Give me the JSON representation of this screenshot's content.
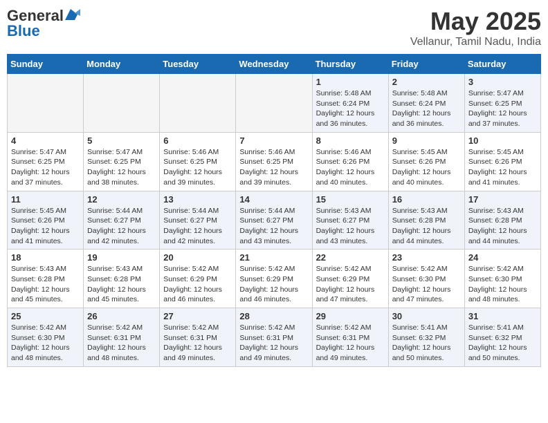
{
  "header": {
    "logo_line1": "General",
    "logo_line2": "Blue",
    "month_title": "May 2025",
    "location": "Vellanur, Tamil Nadu, India"
  },
  "weekdays": [
    "Sunday",
    "Monday",
    "Tuesday",
    "Wednesday",
    "Thursday",
    "Friday",
    "Saturday"
  ],
  "weeks": [
    [
      {
        "day": "",
        "info": ""
      },
      {
        "day": "",
        "info": ""
      },
      {
        "day": "",
        "info": ""
      },
      {
        "day": "",
        "info": ""
      },
      {
        "day": "1",
        "info": "Sunrise: 5:48 AM\nSunset: 6:24 PM\nDaylight: 12 hours\nand 36 minutes."
      },
      {
        "day": "2",
        "info": "Sunrise: 5:48 AM\nSunset: 6:24 PM\nDaylight: 12 hours\nand 36 minutes."
      },
      {
        "day": "3",
        "info": "Sunrise: 5:47 AM\nSunset: 6:25 PM\nDaylight: 12 hours\nand 37 minutes."
      }
    ],
    [
      {
        "day": "4",
        "info": "Sunrise: 5:47 AM\nSunset: 6:25 PM\nDaylight: 12 hours\nand 37 minutes."
      },
      {
        "day": "5",
        "info": "Sunrise: 5:47 AM\nSunset: 6:25 PM\nDaylight: 12 hours\nand 38 minutes."
      },
      {
        "day": "6",
        "info": "Sunrise: 5:46 AM\nSunset: 6:25 PM\nDaylight: 12 hours\nand 39 minutes."
      },
      {
        "day": "7",
        "info": "Sunrise: 5:46 AM\nSunset: 6:25 PM\nDaylight: 12 hours\nand 39 minutes."
      },
      {
        "day": "8",
        "info": "Sunrise: 5:46 AM\nSunset: 6:26 PM\nDaylight: 12 hours\nand 40 minutes."
      },
      {
        "day": "9",
        "info": "Sunrise: 5:45 AM\nSunset: 6:26 PM\nDaylight: 12 hours\nand 40 minutes."
      },
      {
        "day": "10",
        "info": "Sunrise: 5:45 AM\nSunset: 6:26 PM\nDaylight: 12 hours\nand 41 minutes."
      }
    ],
    [
      {
        "day": "11",
        "info": "Sunrise: 5:45 AM\nSunset: 6:26 PM\nDaylight: 12 hours\nand 41 minutes."
      },
      {
        "day": "12",
        "info": "Sunrise: 5:44 AM\nSunset: 6:27 PM\nDaylight: 12 hours\nand 42 minutes."
      },
      {
        "day": "13",
        "info": "Sunrise: 5:44 AM\nSunset: 6:27 PM\nDaylight: 12 hours\nand 42 minutes."
      },
      {
        "day": "14",
        "info": "Sunrise: 5:44 AM\nSunset: 6:27 PM\nDaylight: 12 hours\nand 43 minutes."
      },
      {
        "day": "15",
        "info": "Sunrise: 5:43 AM\nSunset: 6:27 PM\nDaylight: 12 hours\nand 43 minutes."
      },
      {
        "day": "16",
        "info": "Sunrise: 5:43 AM\nSunset: 6:28 PM\nDaylight: 12 hours\nand 44 minutes."
      },
      {
        "day": "17",
        "info": "Sunrise: 5:43 AM\nSunset: 6:28 PM\nDaylight: 12 hours\nand 44 minutes."
      }
    ],
    [
      {
        "day": "18",
        "info": "Sunrise: 5:43 AM\nSunset: 6:28 PM\nDaylight: 12 hours\nand 45 minutes."
      },
      {
        "day": "19",
        "info": "Sunrise: 5:43 AM\nSunset: 6:28 PM\nDaylight: 12 hours\nand 45 minutes."
      },
      {
        "day": "20",
        "info": "Sunrise: 5:42 AM\nSunset: 6:29 PM\nDaylight: 12 hours\nand 46 minutes."
      },
      {
        "day": "21",
        "info": "Sunrise: 5:42 AM\nSunset: 6:29 PM\nDaylight: 12 hours\nand 46 minutes."
      },
      {
        "day": "22",
        "info": "Sunrise: 5:42 AM\nSunset: 6:29 PM\nDaylight: 12 hours\nand 47 minutes."
      },
      {
        "day": "23",
        "info": "Sunrise: 5:42 AM\nSunset: 6:30 PM\nDaylight: 12 hours\nand 47 minutes."
      },
      {
        "day": "24",
        "info": "Sunrise: 5:42 AM\nSunset: 6:30 PM\nDaylight: 12 hours\nand 48 minutes."
      }
    ],
    [
      {
        "day": "25",
        "info": "Sunrise: 5:42 AM\nSunset: 6:30 PM\nDaylight: 12 hours\nand 48 minutes."
      },
      {
        "day": "26",
        "info": "Sunrise: 5:42 AM\nSunset: 6:31 PM\nDaylight: 12 hours\nand 48 minutes."
      },
      {
        "day": "27",
        "info": "Sunrise: 5:42 AM\nSunset: 6:31 PM\nDaylight: 12 hours\nand 49 minutes."
      },
      {
        "day": "28",
        "info": "Sunrise: 5:42 AM\nSunset: 6:31 PM\nDaylight: 12 hours\nand 49 minutes."
      },
      {
        "day": "29",
        "info": "Sunrise: 5:42 AM\nSunset: 6:31 PM\nDaylight: 12 hours\nand 49 minutes."
      },
      {
        "day": "30",
        "info": "Sunrise: 5:41 AM\nSunset: 6:32 PM\nDaylight: 12 hours\nand 50 minutes."
      },
      {
        "day": "31",
        "info": "Sunrise: 5:41 AM\nSunset: 6:32 PM\nDaylight: 12 hours\nand 50 minutes."
      }
    ]
  ]
}
